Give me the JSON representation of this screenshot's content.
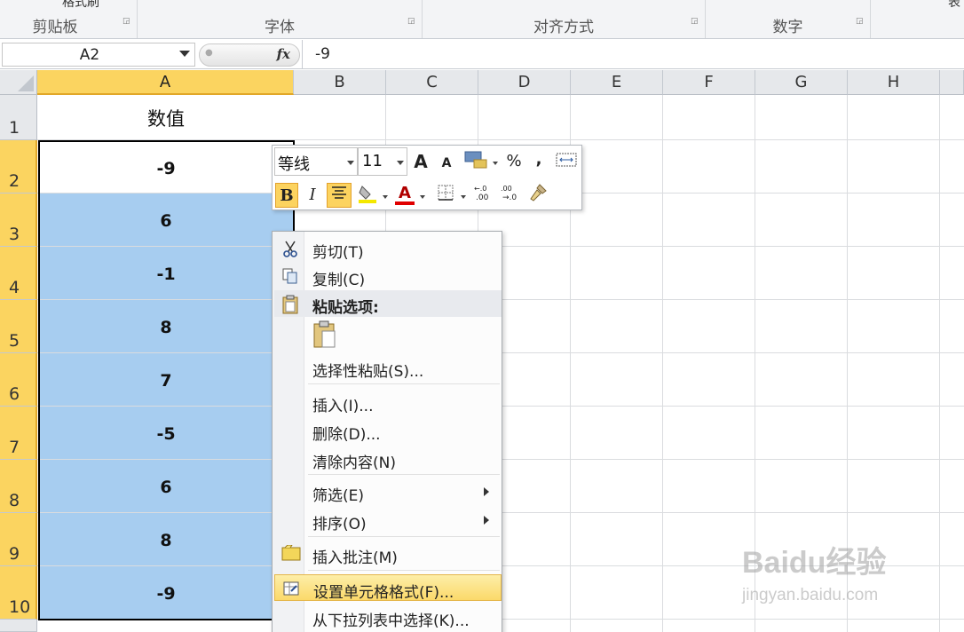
{
  "ribbon": {
    "clipboard_fragment": "格式刷",
    "groups": [
      {
        "label": "剪贴板"
      },
      {
        "label": "字体"
      },
      {
        "label": "对齐方式"
      },
      {
        "label": "数字"
      }
    ],
    "right_fragment": "表"
  },
  "formula_bar": {
    "name_box": "A2",
    "fx_label": "fx",
    "formula": "-9"
  },
  "columns": [
    "A",
    "B",
    "C",
    "D",
    "E",
    "F",
    "G",
    "H"
  ],
  "selected_column": "A",
  "rows": [
    {
      "num": "1",
      "a": "数值"
    },
    {
      "num": "2",
      "a": "-9"
    },
    {
      "num": "3",
      "a": "6"
    },
    {
      "num": "4",
      "a": "-1"
    },
    {
      "num": "5",
      "a": "8"
    },
    {
      "num": "6",
      "a": "7"
    },
    {
      "num": "7",
      "a": "-5"
    },
    {
      "num": "8",
      "a": "6"
    },
    {
      "num": "9",
      "a": "8"
    },
    {
      "num": "10",
      "a": "-9"
    }
  ],
  "mini_toolbar": {
    "font_name": "等线",
    "font_size": "11",
    "grow_font": "A",
    "shrink_font": "A",
    "percent": "%",
    "comma": ",",
    "bold": "B",
    "italic": "I",
    "font_color_glyph": "A"
  },
  "context_menu": {
    "items": [
      {
        "label": "剪切(T)"
      },
      {
        "label": "复制(C)"
      },
      {
        "label": "粘贴选项:"
      },
      {
        "label": "选择性粘贴(S)..."
      },
      {
        "label": "插入(I)..."
      },
      {
        "label": "删除(D)..."
      },
      {
        "label": "清除内容(N)"
      },
      {
        "label": "筛选(E)"
      },
      {
        "label": "排序(O)"
      },
      {
        "label": "插入批注(M)"
      },
      {
        "label": "设置单元格格式(F)..."
      },
      {
        "label": "从下拉列表中选择(K)..."
      }
    ]
  },
  "watermark": {
    "brand": "Baidu经验",
    "url": "jingyan.baidu.com"
  }
}
